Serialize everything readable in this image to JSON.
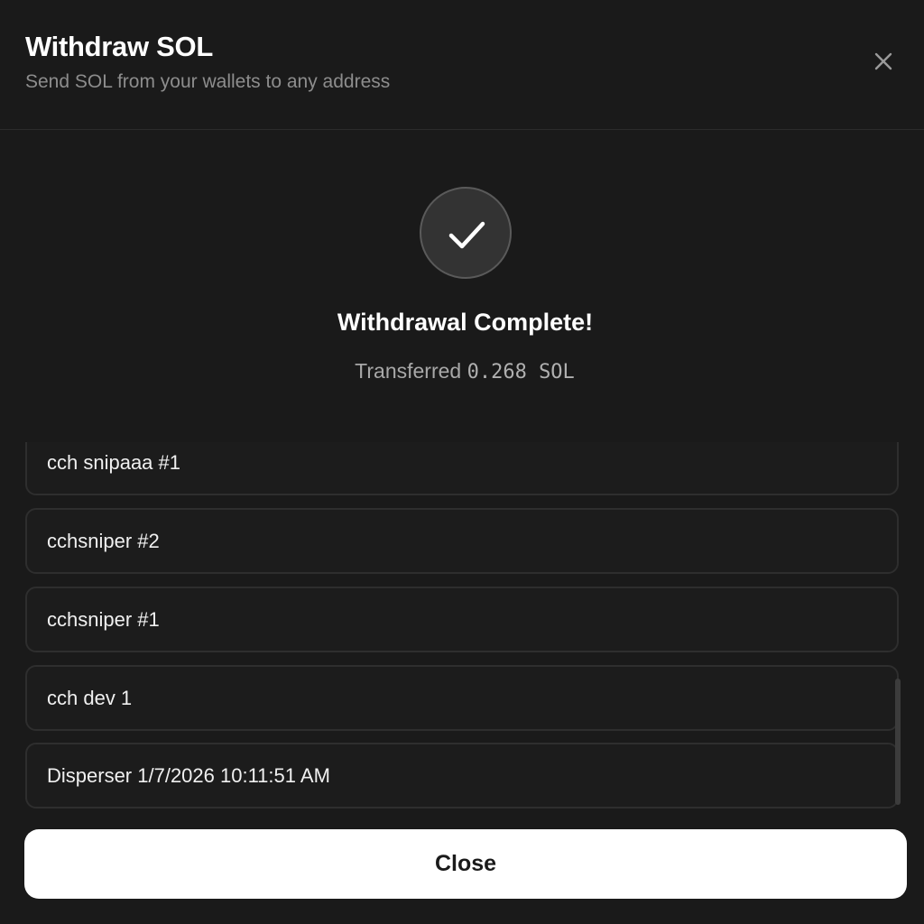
{
  "header": {
    "title": "Withdraw SOL",
    "subtitle": "Send SOL from your wallets to any address",
    "close_icon": "close-icon"
  },
  "status": {
    "icon": "check-icon",
    "title": "Withdrawal Complete!",
    "transfer_prefix": "Transferred",
    "amount": "0.268 SOL"
  },
  "wallets": [
    {
      "label": "cch snipaaa #1"
    },
    {
      "label": "cchsniper #2"
    },
    {
      "label": "cchsniper #1"
    },
    {
      "label": "cch dev 1"
    },
    {
      "label": "Disperser 1/7/2026 10:11:51 AM"
    }
  ],
  "footer": {
    "close_label": "Close"
  }
}
